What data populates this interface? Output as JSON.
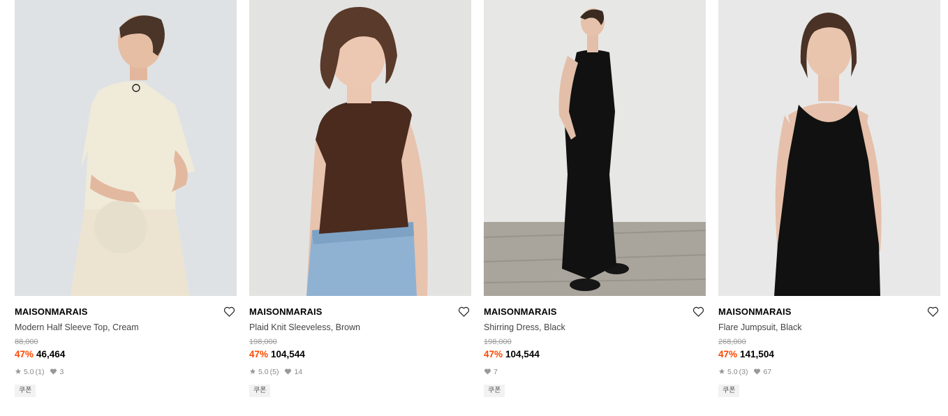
{
  "products": [
    {
      "brand": "MAISONMARAIS",
      "name": "Modern Half Sleeve Top, Cream",
      "original_price": "88,000",
      "discount": "47%",
      "price": "46,464",
      "rating": "5.0",
      "reviews": "(1)",
      "likes": "3",
      "coupon": "쿠폰"
    },
    {
      "brand": "MAISONMARAIS",
      "name": "Plaid Knit Sleeveless, Brown",
      "original_price": "198,000",
      "discount": "47%",
      "price": "104,544",
      "rating": "5.0",
      "reviews": "(5)",
      "likes": "14",
      "coupon": "쿠폰"
    },
    {
      "brand": "MAISONMARAIS",
      "name": "Shirring Dress, Black",
      "original_price": "198,000",
      "discount": "47%",
      "price": "104,544",
      "likes": "7",
      "coupon": "쿠폰"
    },
    {
      "brand": "MAISONMARAIS",
      "name": "Flare Jumpsuit, Black",
      "original_price": "268,000",
      "discount": "47%",
      "price": "141,504",
      "rating": "5.0",
      "reviews": "(3)",
      "likes": "67",
      "coupon": "쿠폰"
    }
  ],
  "colors": {
    "discount": "#ff4800",
    "brand_text": "#000000",
    "name_text": "#444444",
    "muted": "#999999",
    "coupon_bg": "#f2f2f2"
  },
  "icons": {
    "wishlist": "heart-outline-icon",
    "rating": "star-icon",
    "likes": "heart-filled-icon"
  }
}
